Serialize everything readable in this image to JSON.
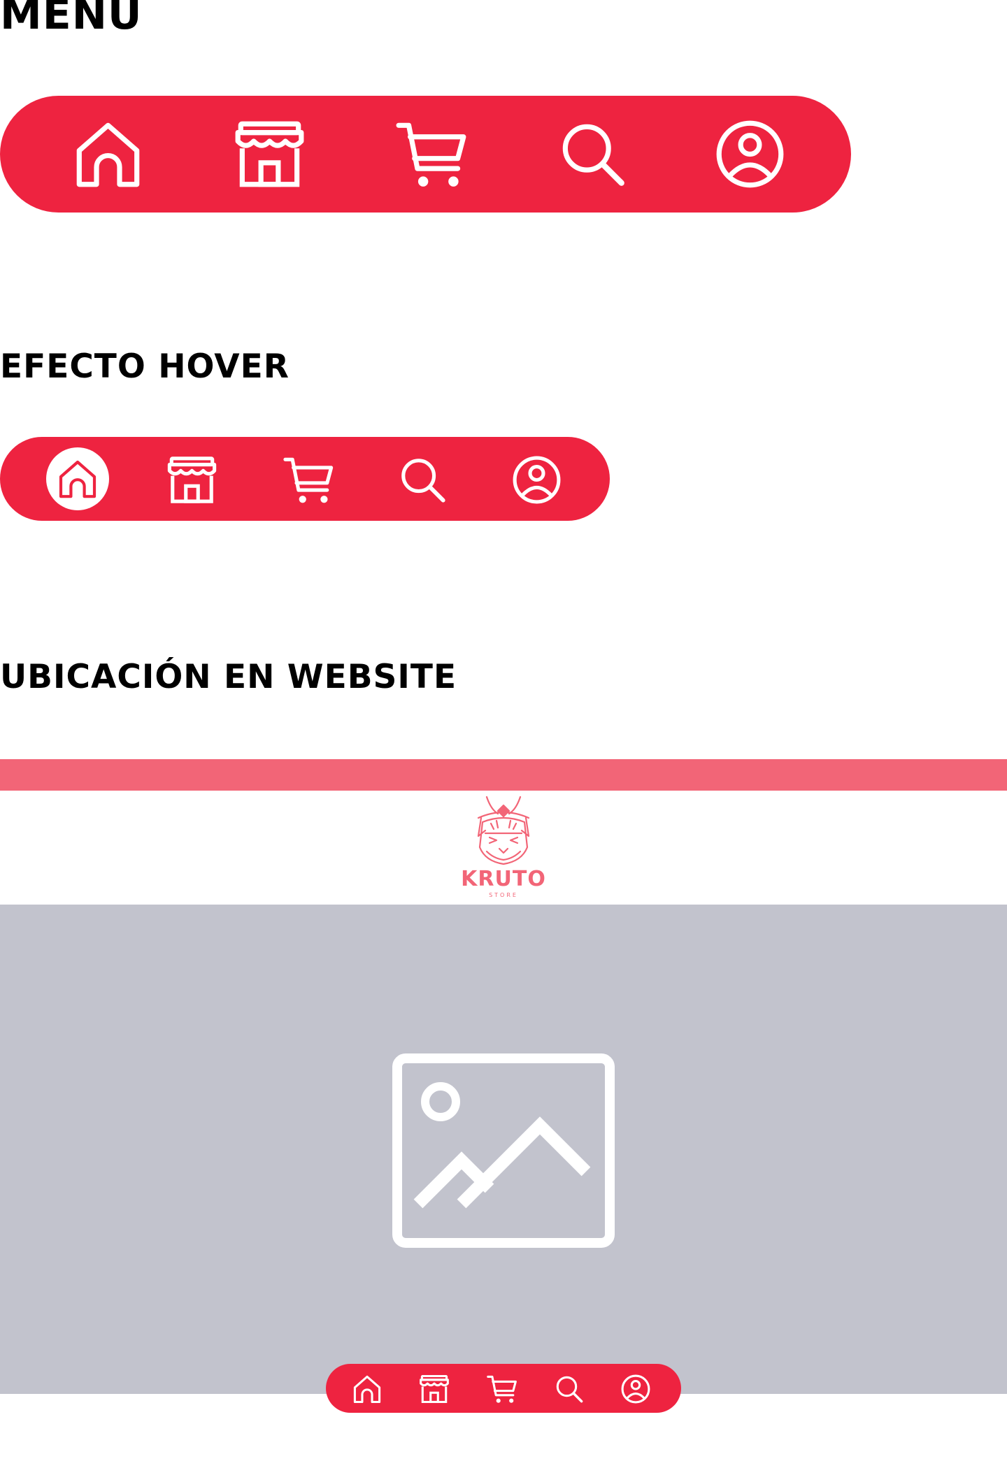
{
  "sections": {
    "menu_title": "MENU",
    "hover_title": "EFECTO HOVER",
    "website_title": "UBICACIÓN EN WEBSITE"
  },
  "nav_items": [
    {
      "name": "home",
      "icon": "home-icon"
    },
    {
      "name": "store",
      "icon": "store-icon"
    },
    {
      "name": "cart",
      "icon": "cart-icon"
    },
    {
      "name": "search",
      "icon": "search-icon"
    },
    {
      "name": "account",
      "icon": "user-icon"
    }
  ],
  "hover_state": {
    "active_item": "home"
  },
  "website": {
    "logo_text": "KRUTO",
    "logo_subtext": "STORE",
    "hero_icon": "image-placeholder-icon"
  },
  "colors": {
    "nav_red": "#ee2340",
    "strip_pink": "#f26577",
    "hero_gray": "#c2c3cd",
    "icon_white": "#ffffff"
  }
}
